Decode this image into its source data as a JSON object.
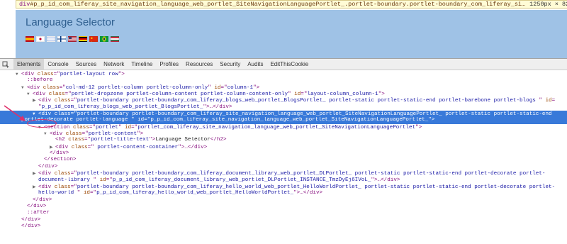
{
  "tooltip": {
    "tag": "div",
    "selector": "#p_p_id_com_liferay_site_navigation_language_web_portlet_SiteNavigationLanguagePortlet_.portlet-boundary.portlet-boundary_com_liferay_si…",
    "size": "1250px × 82px"
  },
  "page": {
    "title": "Language Selector",
    "flags": [
      "es",
      "jp",
      "il",
      "fi",
      "us",
      "de",
      "cn",
      "br",
      "hu"
    ]
  },
  "tabs": [
    "Elements",
    "Console",
    "Sources",
    "Network",
    "Timeline",
    "Profiles",
    "Resources",
    "Security",
    "Audits",
    "EditThisCookie"
  ],
  "active_tab": "Elements",
  "tree": [
    {
      "indent": 0,
      "tri": "▼",
      "parts": [
        [
          "t",
          "<div "
        ],
        [
          "a",
          "class"
        ],
        [
          "p",
          "=\""
        ],
        [
          "v",
          "portlet-layout row"
        ],
        [
          "p",
          "\">"
        ]
      ]
    },
    {
      "indent": 1,
      "tri": "",
      "parts": [
        [
          "t",
          "::before"
        ]
      ]
    },
    {
      "indent": 1,
      "tri": "▼",
      "parts": [
        [
          "t",
          "<div "
        ],
        [
          "a",
          "class"
        ],
        [
          "p",
          "=\""
        ],
        [
          "v",
          "col-md-12 portlet-column portlet-column-only"
        ],
        [
          "p",
          "\" "
        ],
        [
          "a",
          "id"
        ],
        [
          "p",
          "=\""
        ],
        [
          "v",
          "column-1"
        ],
        [
          "p",
          "\">"
        ]
      ]
    },
    {
      "indent": 2,
      "tri": "▼",
      "parts": [
        [
          "t",
          "<div "
        ],
        [
          "a",
          "class"
        ],
        [
          "p",
          "=\""
        ],
        [
          "v",
          "portlet-dropzone portlet-column-content portlet-column-content-only"
        ],
        [
          "p",
          "\" "
        ],
        [
          "a",
          "id"
        ],
        [
          "p",
          "=\""
        ],
        [
          "v",
          "layout-column_column-1"
        ],
        [
          "p",
          "\">"
        ]
      ]
    },
    {
      "indent": 3,
      "tri": "▶",
      "parts": [
        [
          "t",
          "<div "
        ],
        [
          "a",
          "class"
        ],
        [
          "p",
          "=\""
        ],
        [
          "v",
          "portlet-boundary portlet-boundary_com_liferay_blogs_web_portlet_BlogsPortlet_ portlet-static portlet-static-end portlet-barebone portlet-blogs "
        ],
        [
          "p",
          "\" "
        ],
        [
          "a",
          "id"
        ],
        [
          "p",
          "="
        ]
      ]
    },
    {
      "indent": 3,
      "tri": "",
      "parts": [
        [
          "p",
          "\""
        ],
        [
          "v",
          "p_p_id_com_liferay_blogs_web_portlet_BlogsPortlet_"
        ],
        [
          "p",
          "\">…</div>"
        ]
      ]
    },
    {
      "indent": 3,
      "tri": "▼",
      "sel": true,
      "parts": [
        [
          "t",
          "<div "
        ],
        [
          "a",
          "class"
        ],
        [
          "p",
          "=\""
        ],
        [
          "v",
          "portlet-boundary portlet-boundary_com_liferay_site_navigation_language_web_portlet_SiteNavigationLanguagePortlet_ portlet-static portlet-static-end"
        ]
      ]
    },
    {
      "indent": 0,
      "tri": "",
      "sel": true,
      "parts": [
        [
          "v",
          "portlet-decorate portlet-language "
        ],
        [
          "p",
          "\" "
        ],
        [
          "a",
          "id"
        ],
        [
          "p",
          "=\""
        ],
        [
          "v",
          "p_p_id_com_liferay_site_navigation_language_web_portlet_SiteNavigationLanguagePortlet_"
        ],
        [
          "p",
          "\">"
        ]
      ]
    },
    {
      "indent": 4,
      "tri": "▼",
      "parts": [
        [
          "t",
          "<section "
        ],
        [
          "a",
          "class"
        ],
        [
          "p",
          "=\""
        ],
        [
          "v",
          "portlet"
        ],
        [
          "p",
          "\" "
        ],
        [
          "a",
          "id"
        ],
        [
          "p",
          "=\""
        ],
        [
          "v",
          "portlet_com_liferay_site_navigation_language_web_portlet_SiteNavigationLanguagePortlet"
        ],
        [
          "p",
          "\">"
        ]
      ]
    },
    {
      "indent": 5,
      "tri": "▼",
      "parts": [
        [
          "t",
          "<div "
        ],
        [
          "a",
          "class"
        ],
        [
          "p",
          "=\""
        ],
        [
          "v",
          "portlet-content"
        ],
        [
          "p",
          "\">"
        ]
      ]
    },
    {
      "indent": 6,
      "tri": "",
      "parts": [
        [
          "t",
          "<h2 "
        ],
        [
          "a",
          "class"
        ],
        [
          "p",
          "=\""
        ],
        [
          "v",
          "portlet-title-text"
        ],
        [
          "p",
          "\">"
        ],
        [
          "x",
          "Language Selector"
        ],
        [
          "t",
          "</h2>"
        ]
      ]
    },
    {
      "indent": 6,
      "tri": "▶",
      "parts": [
        [
          "t",
          "<div "
        ],
        [
          "a",
          "class"
        ],
        [
          "p",
          "=\""
        ],
        [
          "v",
          " portlet-content-container"
        ],
        [
          "p",
          "\">…</div>"
        ]
      ]
    },
    {
      "indent": 5,
      "tri": "",
      "parts": [
        [
          "t",
          "</div>"
        ]
      ]
    },
    {
      "indent": 4,
      "tri": "",
      "parts": [
        [
          "t",
          "</section>"
        ]
      ]
    },
    {
      "indent": 3,
      "tri": "",
      "parts": [
        [
          "t",
          "</div>"
        ]
      ]
    },
    {
      "indent": 3,
      "tri": "▶",
      "parts": [
        [
          "t",
          "<div "
        ],
        [
          "a",
          "class"
        ],
        [
          "p",
          "=\""
        ],
        [
          "v",
          "portlet-boundary portlet-boundary_com_liferay_document_library_web_portlet_DLPortlet_ portlet-static portlet-static-end portlet-decorate portlet-"
        ]
      ]
    },
    {
      "indent": 3,
      "tri": "",
      "parts": [
        [
          "v",
          "document-library "
        ],
        [
          "p",
          "\" "
        ],
        [
          "a",
          "id"
        ],
        [
          "p",
          "=\""
        ],
        [
          "v",
          "p_p_id_com_liferay_document_library_web_portlet_DLPortlet_INSTANCE_TmzDyEj6IVoL_"
        ],
        [
          "p",
          "\">…</div>"
        ]
      ]
    },
    {
      "indent": 3,
      "tri": "▶",
      "parts": [
        [
          "t",
          "<div "
        ],
        [
          "a",
          "class"
        ],
        [
          "p",
          "=\""
        ],
        [
          "v",
          "portlet-boundary portlet-boundary_com_liferay_hello_world_web_portlet_HelloWorldPortlet_ portlet-static portlet-static-end portlet-decorate portlet-"
        ]
      ]
    },
    {
      "indent": 3,
      "tri": "",
      "parts": [
        [
          "v",
          "hello-world "
        ],
        [
          "p",
          "\" "
        ],
        [
          "a",
          "id"
        ],
        [
          "p",
          "=\""
        ],
        [
          "v",
          "p_p_id_com_liferay_hello_world_web_portlet_HelloWorldPortlet_"
        ],
        [
          "p",
          "\">…</div>"
        ]
      ]
    },
    {
      "indent": 2,
      "tri": "",
      "parts": [
        [
          "t",
          "</div>"
        ]
      ]
    },
    {
      "indent": 1,
      "tri": "",
      "parts": [
        [
          "t",
          "</div>"
        ]
      ]
    },
    {
      "indent": 1,
      "tri": "",
      "parts": [
        [
          "t",
          "::after"
        ]
      ]
    },
    {
      "indent": 0,
      "tri": "",
      "parts": [
        [
          "t",
          "</div>"
        ]
      ]
    },
    {
      "indent": 0,
      "tri": "",
      "parts": [
        [
          "t",
          "</div>"
        ]
      ]
    }
  ],
  "colors": {
    "highlight": "#9fc2e6",
    "selected_row": "#3879d9",
    "tag": "#881280",
    "attr_name": "#994500",
    "attr_value": "#1a1aa6",
    "annotation": "#e0306a"
  }
}
